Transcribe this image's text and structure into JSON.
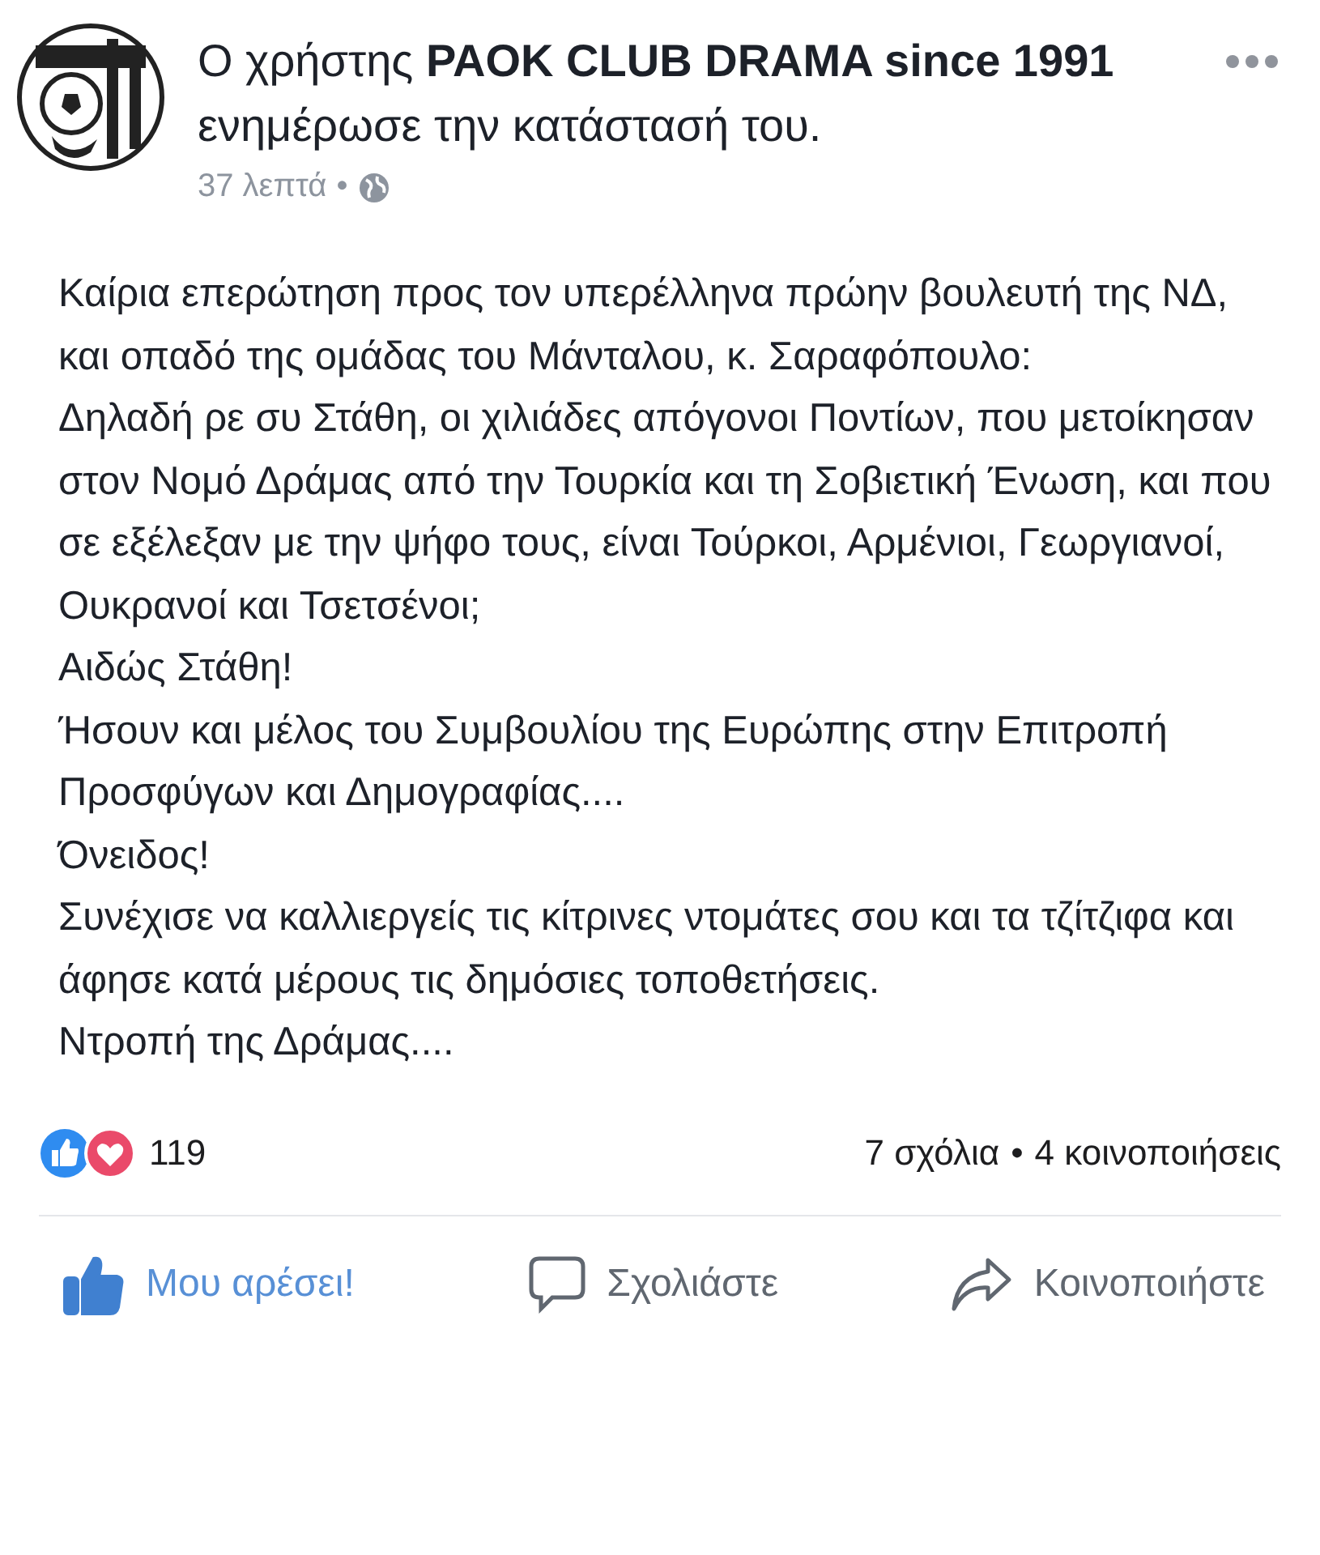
{
  "post": {
    "author_line": "Ο χρήστης **PAOK CLUB DRAMA since 1991** ενημέρωσε την κατάστασή του.",
    "time": "37 λεπτά",
    "separator": "•",
    "paragraphs": [
      "Καίρια επερώτηση προς τον υπερέλληνα πρώην βουλευτή της ΝΔ, και οπαδό της ομάδας του Μάνταλου, κ. Σαραφόπουλο:",
      "Δηλαδή ρε συ Στάθη, οι χιλιάδες απόγονοι Ποντίων, που μετοίκησαν στον Νομό Δράμας από την Τουρκία και τη Σοβιετική Ένωση, και που σε εξέλεξαν με την ψήφο τους, είναι Τούρκοι, Αρμένιοι, Γεωργιανοί, Ουκρανοί και Τσετσένοι;",
      "Αιδώς Στάθη!",
      "Ήσουν και μέλος του Συμβουλίου της Ευρώπης στην Επιτροπή Προσφύγων και Δημογραφίας....",
      "Όνειδος!",
      "Συνέχισε να καλλιεργείς τις κίτρινες ντομάτες σου και τα τζίτζιφα και άφησε κατά μέρους τις δημόσιες τοποθετήσεις.",
      "Ντροπή της Δράμας...."
    ]
  },
  "stats": {
    "reactions": "119",
    "comments": "7 σχόλια",
    "separator": "•",
    "shares": "4 κοινοποιήσεις"
  },
  "actions": [
    {
      "kind": "like",
      "label": "Μου αρέσει!",
      "selected": true
    },
    {
      "kind": "comment",
      "label": "Σχολιάστε",
      "selected": false
    },
    {
      "kind": "share",
      "label": "Κοινοποιήστε",
      "selected": false
    }
  ]
}
